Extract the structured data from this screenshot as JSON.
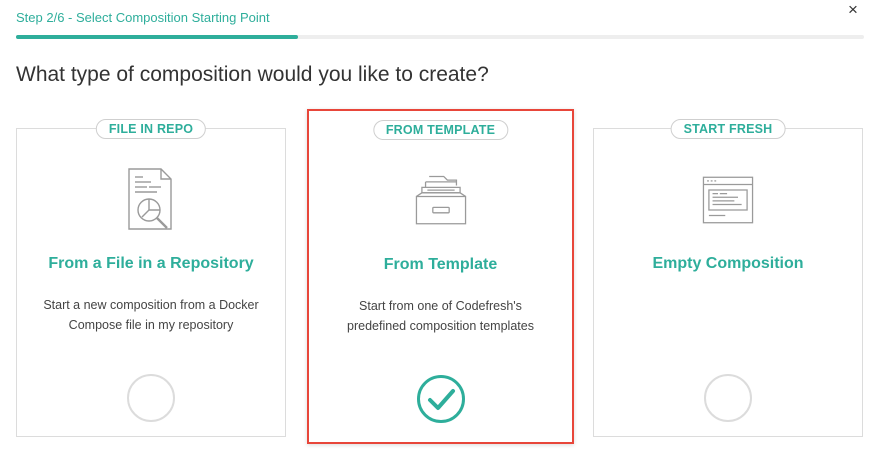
{
  "header": {
    "step_title": "Step 2/6 - Select Composition Starting Point",
    "progress_fraction": 0.333,
    "close_glyph": "×"
  },
  "heading": "What type of composition would you like to create?",
  "colors": {
    "accent": "#2eae9b",
    "selection_border": "#e8463a",
    "radio_off": "#dcdcdc"
  },
  "cards": [
    {
      "tag": "FILE IN REPO",
      "title": "From a File in a Repository",
      "description": "Start a new composition from a Docker Compose file in my repository",
      "icon": "file-search-icon",
      "selected": false
    },
    {
      "tag": "FROM TEMPLATE",
      "title": "From Template",
      "description": "Start from one of Codefresh's predefined composition templates",
      "icon": "file-cabinet-icon",
      "selected": true
    },
    {
      "tag": "START FRESH",
      "title": "Empty Composition",
      "description": "",
      "icon": "browser-window-icon",
      "selected": false
    }
  ]
}
